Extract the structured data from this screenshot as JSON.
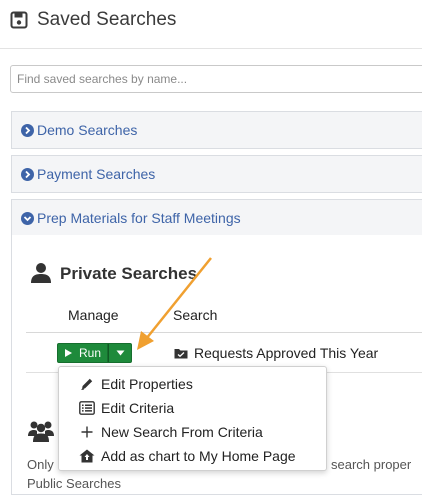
{
  "header": {
    "title": "Saved Searches"
  },
  "search": {
    "placeholder": "Find saved searches by name..."
  },
  "accordions": [
    {
      "label": "Demo Searches",
      "expanded": false
    },
    {
      "label": "Payment Searches",
      "expanded": false
    },
    {
      "label": "Prep Materials for Staff Meetings",
      "expanded": true
    }
  ],
  "private": {
    "title": "Private Searches",
    "columns": {
      "manage": "Manage",
      "search": "Search"
    },
    "rows": [
      {
        "run_label": "Run",
        "search_name": "Requests Approved This Year"
      }
    ]
  },
  "menu": {
    "items": [
      {
        "label": "Edit Properties",
        "icon": "pencil-icon"
      },
      {
        "label": "Edit Criteria",
        "icon": "list-icon"
      },
      {
        "label": "New Search From Criteria",
        "icon": "plus-icon"
      },
      {
        "label": "Add as chart to My Home Page",
        "icon": "home-upload-icon"
      }
    ]
  },
  "public": {
    "partial_left": "Only",
    "partial_right": "search proper",
    "partial_bottom": "Public Searches"
  },
  "colors": {
    "accent_blue": "#3e64a8",
    "run_green": "#1e8a3b",
    "annotation_arrow": "#f0a030"
  }
}
